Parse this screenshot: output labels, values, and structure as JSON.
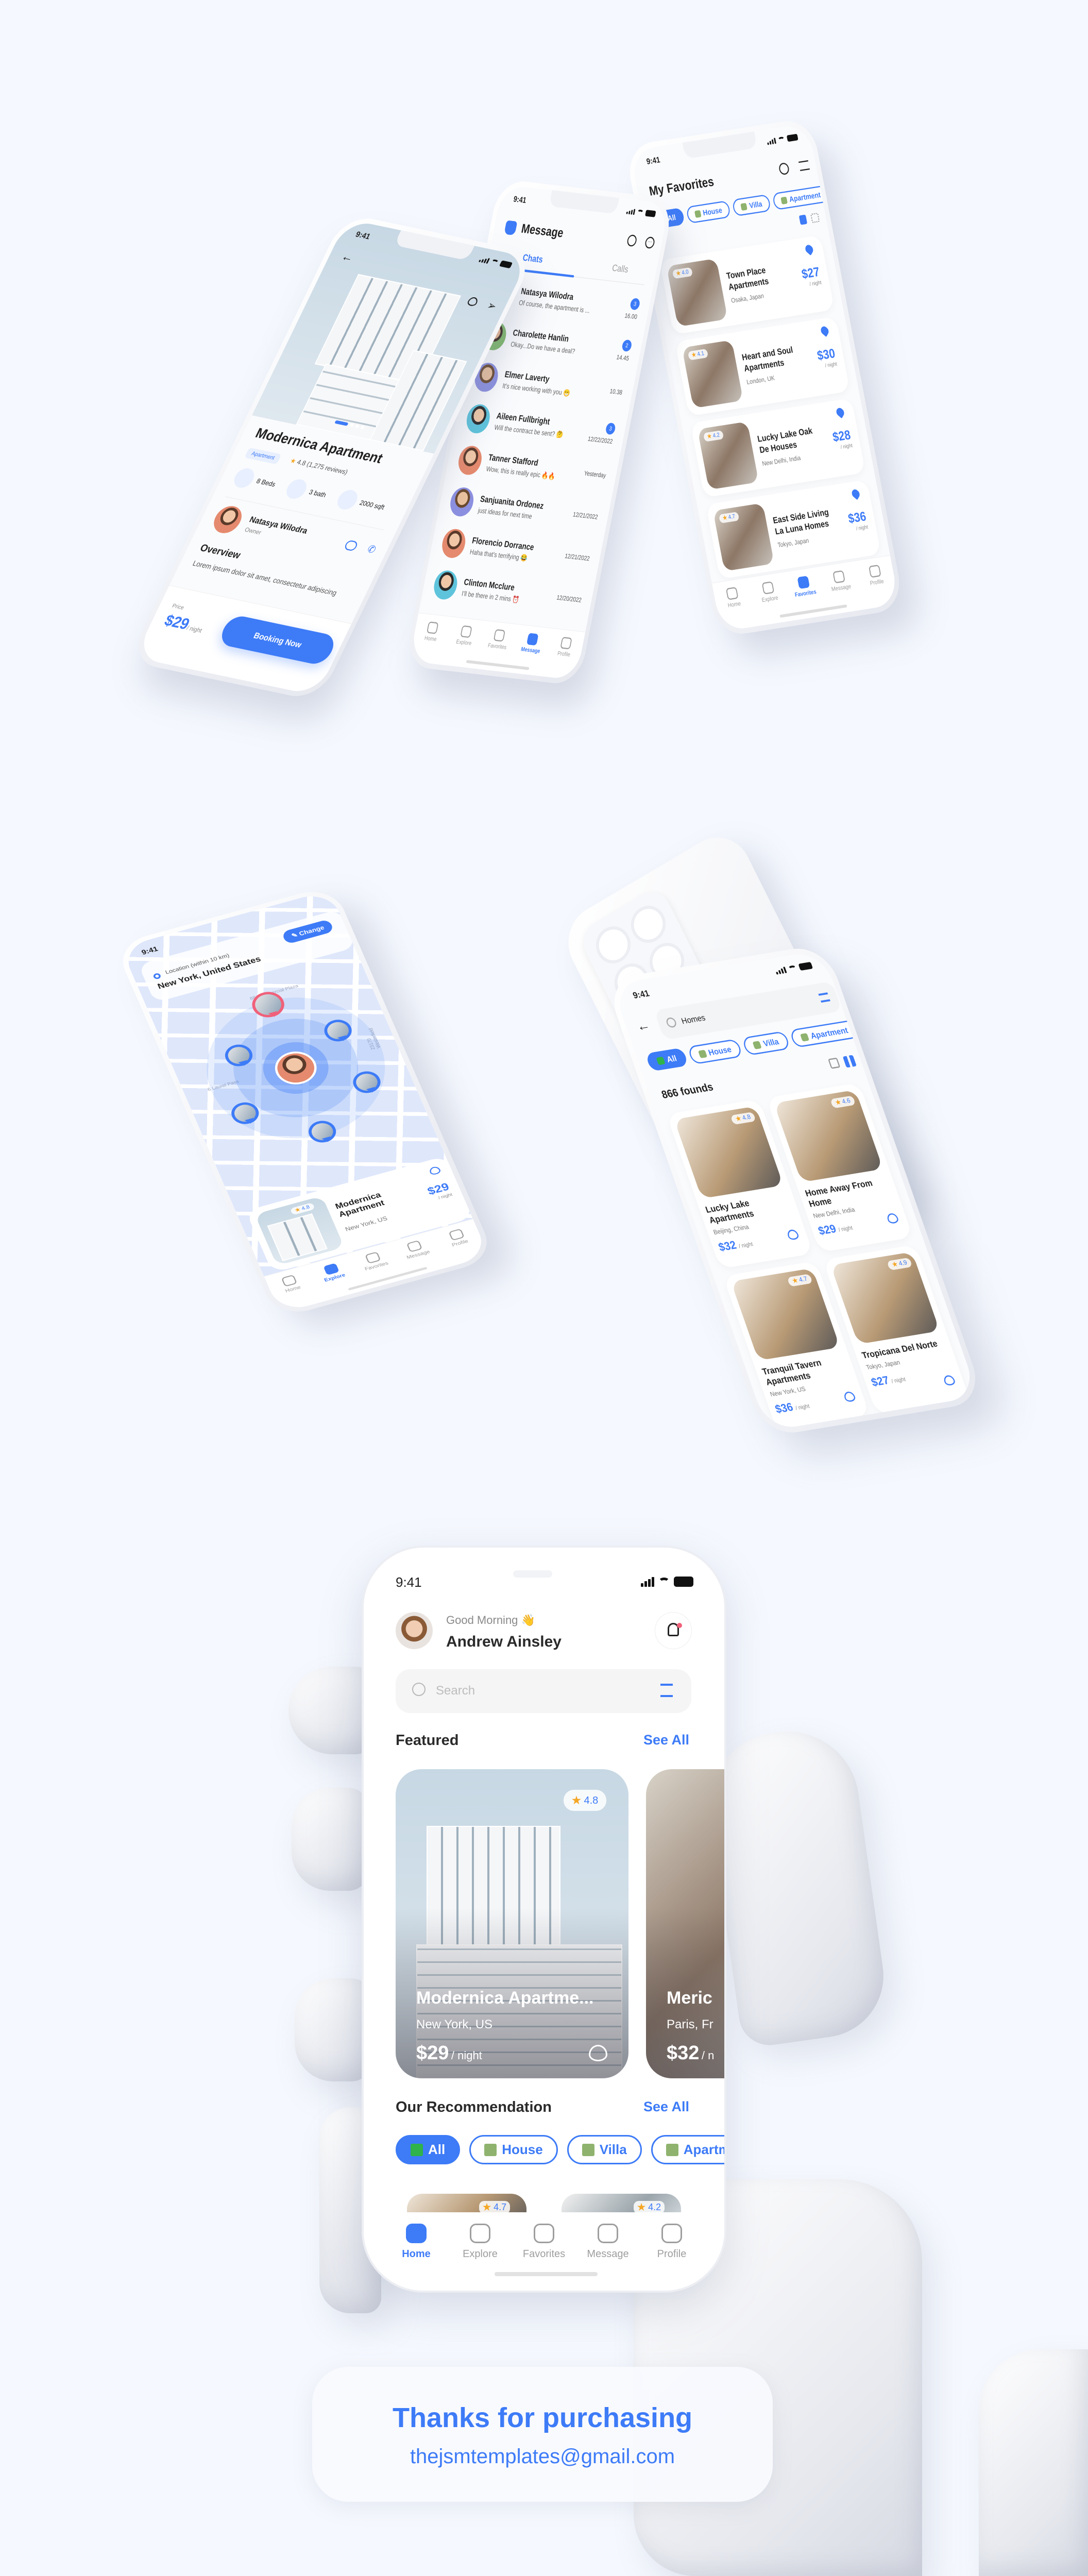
{
  "colors": {
    "accent": "#3d7bf7",
    "background": "#f5f8fe",
    "favorite_red": "#f0607a",
    "star": "#f5a623"
  },
  "status_time": "9:41",
  "nav": [
    {
      "label": "Home",
      "icon": "home-icon"
    },
    {
      "label": "Explore",
      "icon": "search-icon"
    },
    {
      "label": "Favorites",
      "icon": "heart-icon"
    },
    {
      "label": "Message",
      "icon": "chat-bubble-icon"
    },
    {
      "label": "Profile",
      "icon": "user-icon"
    }
  ],
  "chips": [
    {
      "label": "All",
      "icon": "check-box-icon"
    },
    {
      "label": "House",
      "icon": "house-icon"
    },
    {
      "label": "Villa",
      "icon": "villa-icon"
    },
    {
      "label": "Apartment",
      "icon": "building-icon"
    }
  ],
  "detail": {
    "title": "Modernica Apartment",
    "type_badge": "Apartment",
    "rating": "4.8",
    "reviews": "(1,275 reviews)",
    "features": [
      {
        "label": "8 Beds",
        "icon": "bed-icon"
      },
      {
        "label": "3 bath",
        "icon": "bathtub-icon"
      },
      {
        "label": "2000 sqft",
        "icon": "area-icon"
      }
    ],
    "owner_name": "Natasya Wilodra",
    "owner_role": "Owner",
    "overview_title": "Overview",
    "overview_text": "Lorem ipsum dolor sit amet, consectetur adipiscing",
    "price_label": "Price",
    "price": "$29",
    "per": "/ night",
    "cta": "Booking Now"
  },
  "message": {
    "title": "Message",
    "tabs": [
      "Chats",
      "Calls"
    ],
    "active_tab": "Chats",
    "active_nav": "Message",
    "chats": [
      {
        "name": "Natasya Wilodra",
        "text": "Of course, the apartment is ...",
        "time": "16.00",
        "unread": "3"
      },
      {
        "name": "Charolette Hanlin",
        "text": "Okay...Do we have a deal?",
        "time": "14.45",
        "unread": "2"
      },
      {
        "name": "Elmer Laverty",
        "text": "It's nice working with you 😁",
        "time": "10.38",
        "unread": ""
      },
      {
        "name": "Aileen Fullbright",
        "text": "Will the contract be sent? 🤔",
        "time": "12/22/2022",
        "unread": "3"
      },
      {
        "name": "Tanner Stafford",
        "text": "Wow, this is really epic 🔥🔥",
        "time": "Yesterday",
        "unread": ""
      },
      {
        "name": "Sanjuanita Ordonez",
        "text": "just ideas for next time",
        "time": "12/21/2022",
        "unread": ""
      },
      {
        "name": "Florencio Dorrance",
        "text": "Haha that's terrifying 😂",
        "time": "12/21/2022",
        "unread": ""
      },
      {
        "name": "Clinton Mcclure",
        "text": "I'll be there in 2 mins ⏰",
        "time": "12/20/2022",
        "unread": ""
      }
    ]
  },
  "favorites": {
    "title": "My Favorites",
    "active_nav": "Favorites",
    "items": [
      {
        "name": "Town Place Apartments",
        "location": "Osaka, Japan",
        "rating": "4.0",
        "price": "$27",
        "per": "/ night"
      },
      {
        "name": "Heart and Soul Apartments",
        "location": "London, UK",
        "rating": "4.1",
        "price": "$30",
        "per": "/ night"
      },
      {
        "name": "Lucky Lake Oak De Houses",
        "location": "New Delhi, India",
        "rating": "4.2",
        "price": "$28",
        "per": "/ night"
      },
      {
        "name": "East Side Living La Luna Homes",
        "location": "Tokyo, Japan",
        "rating": "4.7",
        "price": "$36",
        "per": "/ night"
      }
    ]
  },
  "map": {
    "location_label": "Location (within 10 km)",
    "location_value": "New York, United States",
    "change_label": "Change",
    "streets": [
      "88 Commercial Plaza",
      "6 Laurel Pass",
      "23170 Westerfield"
    ],
    "card": {
      "name": "Modernica Apartment",
      "location": "New York, US",
      "rating": "4.8",
      "price": "$29",
      "per": "/ night"
    },
    "active_nav": "Explore"
  },
  "search": {
    "query": "Homes",
    "count": "866 founds",
    "items": [
      {
        "name": "Lucky Lake Apartments",
        "location": "Beijing, China",
        "rating": "4.8",
        "price": "$32",
        "per": "/ night"
      },
      {
        "name": "Home Away From Home",
        "location": "New Delhi, India",
        "rating": "4.6",
        "price": "$29",
        "per": "/ night"
      },
      {
        "name": "Tranquil Tavern Apartments",
        "location": "New York, US",
        "rating": "4.7",
        "price": "$36",
        "per": "/ night"
      },
      {
        "name": "Tropicana Del Norte",
        "location": "Tokyo, Japan",
        "rating": "4.9",
        "price": "$27",
        "per": "/ night"
      }
    ],
    "more_ratings": [
      "4.7",
      "4.8"
    ]
  },
  "home": {
    "greeting": "Good Morning 👋",
    "user_name": "Andrew Ainsley",
    "search_placeholder": "Search",
    "featured_title": "Featured",
    "see_all": "See All",
    "featured": [
      {
        "name": "Modernica Apartme...",
        "location": "New York, US",
        "rating": "4.8",
        "price": "$29",
        "per": "/ night"
      },
      {
        "name": "Meric",
        "location": "Paris, Fr",
        "price": "$32",
        "per": "/ n"
      }
    ],
    "recommendation_title": "Our Recommendation",
    "rec_ratings": [
      "4.7",
      "4.2"
    ],
    "active_nav": "Home"
  },
  "footer": {
    "thanks": "Thanks for purchasing",
    "email": "thejsmtemplates@gmail.com"
  }
}
